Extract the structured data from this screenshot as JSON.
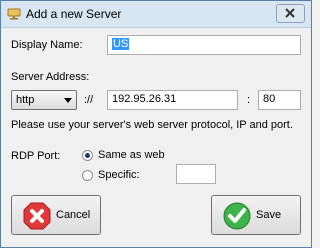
{
  "window": {
    "title": "Add a new Server"
  },
  "form": {
    "display_name": {
      "label": "Display Name:",
      "value": "US"
    },
    "server_address": {
      "label": "Server Address:",
      "protocol": "http",
      "separator": "://",
      "ip": "192.95.26.31",
      "port_separator": ":",
      "port": "80"
    },
    "hint": "Please use your server's web server protocol, IP and port.",
    "rdp": {
      "label": "RDP Port:",
      "option_same": "Same as web",
      "option_specific": "Specific:",
      "selected": "same",
      "specific_value": ""
    }
  },
  "buttons": {
    "cancel": "Cancel",
    "save": "Save"
  }
}
